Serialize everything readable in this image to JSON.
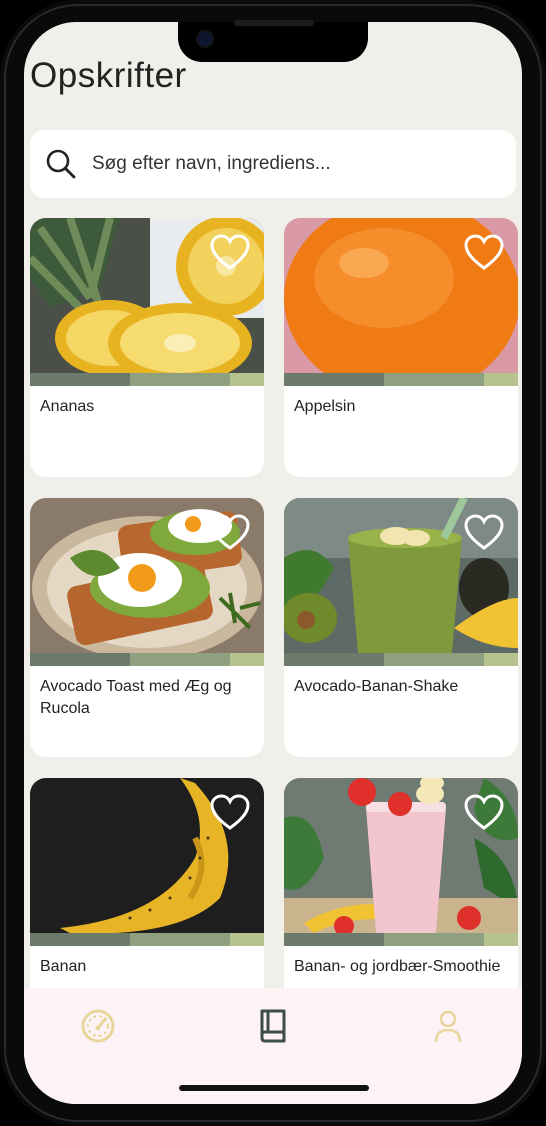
{
  "page": {
    "title": "Opskrifter"
  },
  "search": {
    "placeholder": "Søg efter navn, ingrediens..."
  },
  "recipes": [
    {
      "name": "Ananas"
    },
    {
      "name": "Appelsin"
    },
    {
      "name": "Avocado Toast med Æg og Rucola"
    },
    {
      "name": "Avocado-Banan-Shake"
    },
    {
      "name": "Banan"
    },
    {
      "name": "Banan- og jordbær-Smoothie"
    }
  ],
  "tabs": [
    {
      "icon": "dashboard-gauge-icon",
      "active": false
    },
    {
      "icon": "recipe-book-icon",
      "active": true
    },
    {
      "icon": "profile-icon",
      "active": false
    }
  ],
  "colors": {
    "background": "#f1efea",
    "stripe_dark": "#6b7a6a",
    "stripe_mid": "#8fa080",
    "stripe_light": "#b7c38e",
    "tab_inactive": "#e8d59a",
    "tab_active": "#3d4d45"
  }
}
